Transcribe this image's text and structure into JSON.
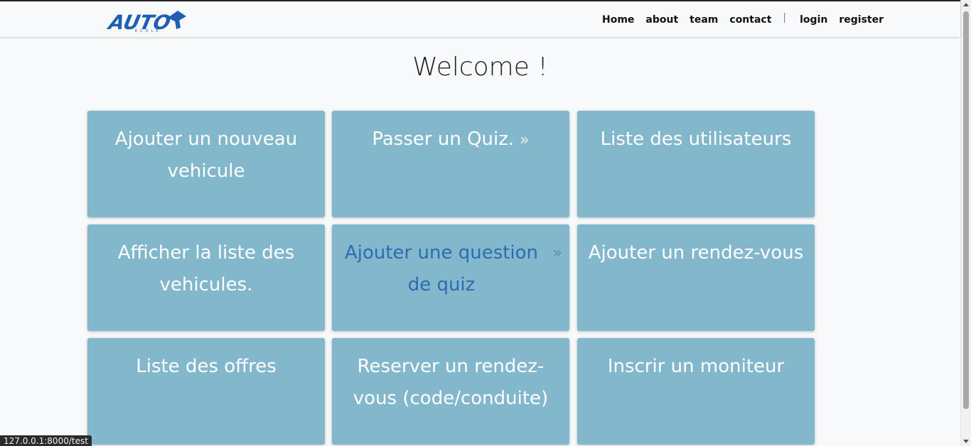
{
  "nav": {
    "logo_text": "AUTO",
    "logo_subtext": "ECOLE",
    "links": [
      "Home",
      "about",
      "team",
      "contact"
    ],
    "separator": "|",
    "auth_links": [
      "login",
      "register"
    ]
  },
  "main": {
    "title": "Welcome !",
    "cards": [
      {
        "label": "Ajouter un nouveau vehicule",
        "arrow": ""
      },
      {
        "label": "Passer un Quiz.",
        "arrow": "»"
      },
      {
        "label": "Liste des utilisateurs",
        "arrow": ""
      },
      {
        "label": "Afficher la liste des vehicules.",
        "arrow": ""
      },
      {
        "label": "Ajouter une question de quiz",
        "arrow": "»"
      },
      {
        "label": "Ajouter un rendez-vous",
        "arrow": ""
      },
      {
        "label": "Liste des offres",
        "arrow": ""
      },
      {
        "label": "Reserver un rendez-vous (code/conduite)",
        "arrow": ""
      },
      {
        "label": "Inscrir un moniteur",
        "arrow": ""
      }
    ]
  },
  "status_bar": {
    "url": "127.0.0.1:8000/test"
  },
  "colors": {
    "card_bg": "#83b7cb",
    "card_text": "#ffffff",
    "card_hover_text": "#2d6cb0",
    "logo_blue": "#1f5fb3"
  }
}
